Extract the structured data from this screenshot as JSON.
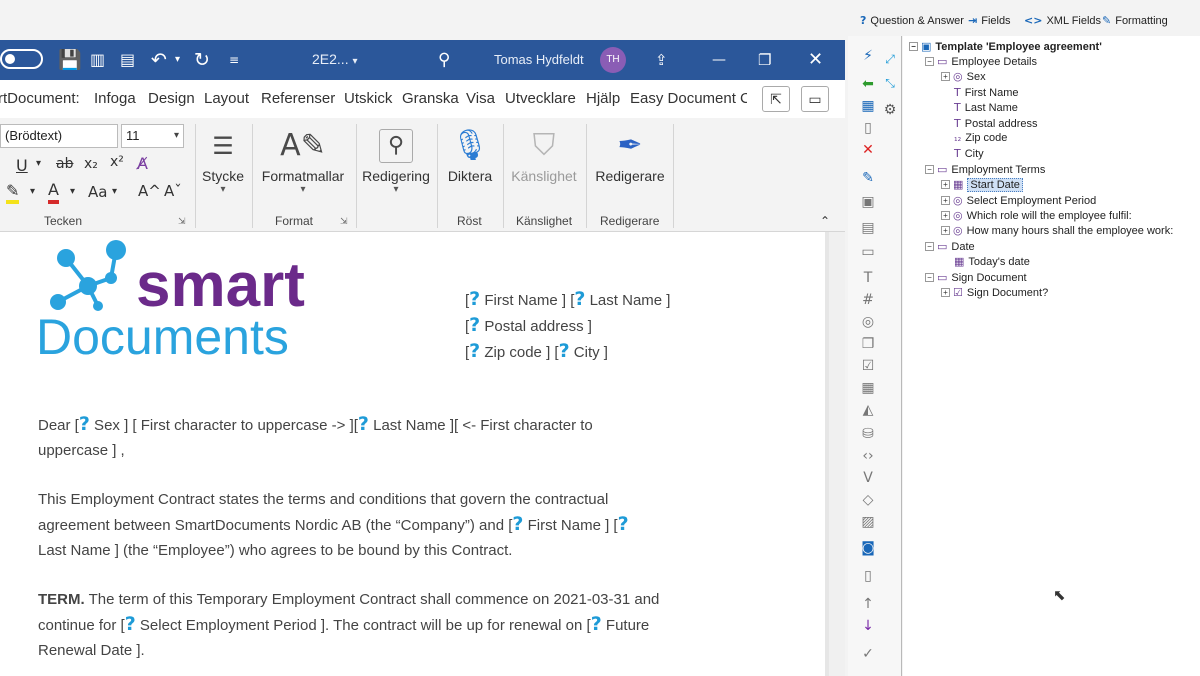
{
  "titlebar": {
    "doc_name": "2E2...",
    "user_name": "Tomas Hydfeldt",
    "user_initials": "TH"
  },
  "menu_tabs": [
    "rtDocument:",
    "Infoga",
    "Design",
    "Layout",
    "Referenser",
    "Utskick",
    "Granska",
    "Visa",
    "Utvecklare",
    "Hjälp",
    "Easy Document C"
  ],
  "ribbon": {
    "font_name": "(Brödtext)",
    "font_size": "11",
    "groups": {
      "tecken": "Tecken",
      "format": "Format",
      "rost": "Röst",
      "kanslighet": "Känslighet",
      "redigerare": "Redigerare"
    },
    "buttons": {
      "stycke": "Stycke",
      "formatmallar": "Formatmallar",
      "redigering": "Redigering",
      "diktera": "Diktera",
      "kanslighet": "Känslighet",
      "redigerare": "Redigerare"
    },
    "font_glyphs": {
      "underline": "U",
      "strike": "ab",
      "subscript": "x₂",
      "superscript": "x²",
      "font_color": "A",
      "change_case": "Aa",
      "grow": "A^",
      "shrink": "Aˇ"
    }
  },
  "document": {
    "logo": {
      "word_top": "smart",
      "word_bottom": "Documents"
    },
    "address": {
      "line1": [
        {
          "q": "?",
          "text": " First Name ] ["
        },
        {
          "q": "?",
          "text": " Last Name ]"
        }
      ],
      "line2": [
        {
          "q": "?",
          "text": " Postal address ]"
        }
      ],
      "line3": [
        {
          "q": "?",
          "text": " Zip code ] ["
        },
        {
          "q": "?",
          "text": " City ]"
        }
      ]
    },
    "greeting": {
      "p1": "Dear [",
      "f1": " Sex ] [  First character to uppercase -> ][",
      "f2": " Last Name ][  <- First character to",
      "p2": "uppercase ] ,"
    },
    "intro": {
      "a": "This Employment Contract states the terms and conditions that govern the contractual",
      "b": "agreement between SmartDocuments Nordic AB (the “Company”) and [",
      "c": " First Name ] [",
      "d": "Last Name ] (the “Employee”) who agrees to be bound by this Contract."
    },
    "term": {
      "label": "TERM.",
      "a": " The term of this Temporary Employment Contract shall commence on 2021-03-31 and",
      "b": "continue for [",
      "c": " Select Employment Period ]. The contract will be up for renewal on [",
      "d": " Future",
      "e": "Renewal Date ]."
    }
  },
  "addin": {
    "tabs": {
      "qa": "Question & Answer",
      "fields": "Fields",
      "xml": "XML Fields",
      "formatting": "Formatting"
    },
    "tree": {
      "root": "Template 'Employee agreement'",
      "employee_details": "Employee Details",
      "sex": "Sex",
      "first_name": "First Name",
      "last_name": "Last Name",
      "postal_address": "Postal address",
      "zip_code": "Zip code",
      "city": "City",
      "employment_terms": "Employment Terms",
      "start_date": "Start Date",
      "select_period": "Select Employment Period",
      "role": "Which role will the employee fulfil:",
      "hours": "How many hours shall the employee work:",
      "date": "Date",
      "todays_date": "Today's date",
      "sign_document": "Sign Document",
      "sign_q": "Sign Document?"
    }
  },
  "colors": {
    "word_blue": "#2b579a",
    "field_blue": "#1e9bd7",
    "logo_purple": "#6b2a8a",
    "logo_blue": "#2aa3de"
  }
}
